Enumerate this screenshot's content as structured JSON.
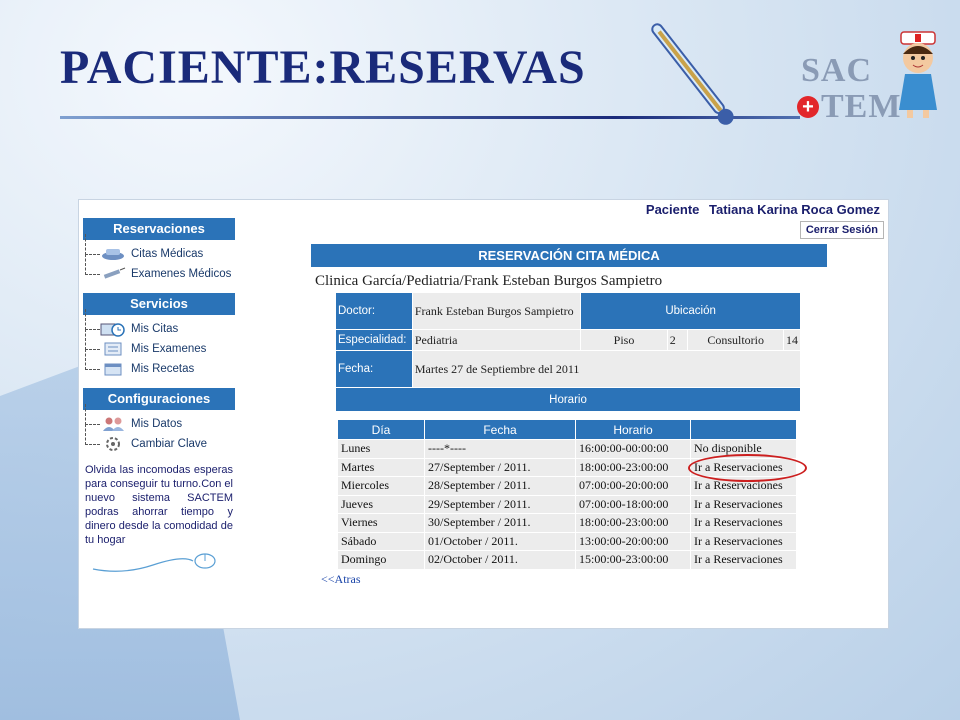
{
  "slide": {
    "title": "PACIENTE:RESERVAS",
    "logo_top": "SAC",
    "logo_bottom": "TEM"
  },
  "app": {
    "user_label": "Paciente",
    "user_name": "Tatiana Karina Roca Gomez",
    "logout_label": "Cerrar Sesión"
  },
  "sidebar": {
    "groups": [
      {
        "header": "Reservaciones",
        "items": [
          {
            "label": "Citas Médicas",
            "icon": "appointment-icon"
          },
          {
            "label": "Examenes Médicos",
            "icon": "syringe-icon"
          }
        ]
      },
      {
        "header": "Servicios",
        "items": [
          {
            "label": "Mis Citas",
            "icon": "clock-icon"
          },
          {
            "label": "Mis Examenes",
            "icon": "exam-icon"
          },
          {
            "label": "Mis Recetas",
            "icon": "prescription-icon"
          }
        ]
      },
      {
        "header": "Configuraciones",
        "items": [
          {
            "label": "Mis Datos",
            "icon": "users-icon"
          },
          {
            "label": "Cambiar Clave",
            "icon": "key-icon"
          }
        ]
      }
    ],
    "note": "Olvida las incomodas esperas para conseguir tu turno.Con el nuevo sistema SACTEM podras ahorrar tiempo y dinero desde la comodidad de tu hogar"
  },
  "reservation": {
    "header": "RESERVACIÓN CITA MÉDICA",
    "clinic_line": "Clinica García/Pediatria/Frank Esteban Burgos Sampietro",
    "doctor_label": "Doctor:",
    "doctor_value": "Frank Esteban Burgos Sampietro",
    "location_label": "Ubicación",
    "specialty_label": "Especialidad:",
    "specialty_value": "Pediatria",
    "floor_label": "Piso",
    "floor_value": "2",
    "office_label": "Consultorio",
    "office_value": "14",
    "date_label": "Fecha:",
    "date_value": "Martes 27 de Septiembre del 2011",
    "schedule_label": "Horario"
  },
  "schedule": {
    "columns": [
      "Día",
      "Fecha",
      "Horario",
      ""
    ],
    "rows": [
      {
        "day": "Lunes",
        "date": "----*----",
        "hours": "16:00:00-00:00:00",
        "action": "No disponible"
      },
      {
        "day": "Martes",
        "date": "27/September / 2011.",
        "hours": "18:00:00-23:00:00",
        "action": "Ir a Reservaciones"
      },
      {
        "day": "Miercoles",
        "date": "28/September / 2011.",
        "hours": "07:00:00-20:00:00",
        "action": "Ir a Reservaciones"
      },
      {
        "day": "Jueves",
        "date": "29/September / 2011.",
        "hours": "07:00:00-18:00:00",
        "action": "Ir a Reservaciones"
      },
      {
        "day": "Viernes",
        "date": "30/September / 2011.",
        "hours": "18:00:00-23:00:00",
        "action": "Ir a Reservaciones"
      },
      {
        "day": "Sábado",
        "date": "01/October / 2011.",
        "hours": "13:00:00-20:00:00",
        "action": "Ir a Reservaciones"
      },
      {
        "day": "Domingo",
        "date": "02/October / 2011.",
        "hours": "15:00:00-23:00:00",
        "action": "Ir a Reservaciones"
      }
    ],
    "back_label": "<<Atras"
  },
  "colors": {
    "header_blue": "#2b73b8",
    "title_navy": "#1a2a7a",
    "highlight_red": "#cc1f1f"
  }
}
